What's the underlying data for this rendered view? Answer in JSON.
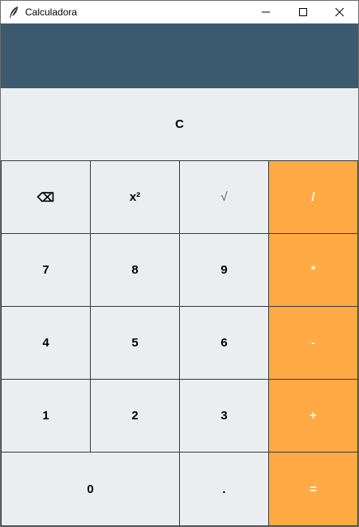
{
  "window": {
    "title": "Calculadora"
  },
  "display": {
    "value": ""
  },
  "colors": {
    "display_bg": "#3c5a6e",
    "key_bg": "#ebeef1",
    "operator_bg": "#ffaa44",
    "operator_text": "#ffffff"
  },
  "keys": {
    "clear": "C",
    "backspace": "⌫",
    "square": "x²",
    "sqrt": "√",
    "divide": "/",
    "seven": "7",
    "eight": "8",
    "nine": "9",
    "multiply": "*",
    "four": "4",
    "five": "5",
    "six": "6",
    "subtract": "-",
    "one": "1",
    "two": "2",
    "three": "3",
    "add": "+",
    "zero": "0",
    "decimal": ".",
    "equals": "="
  }
}
